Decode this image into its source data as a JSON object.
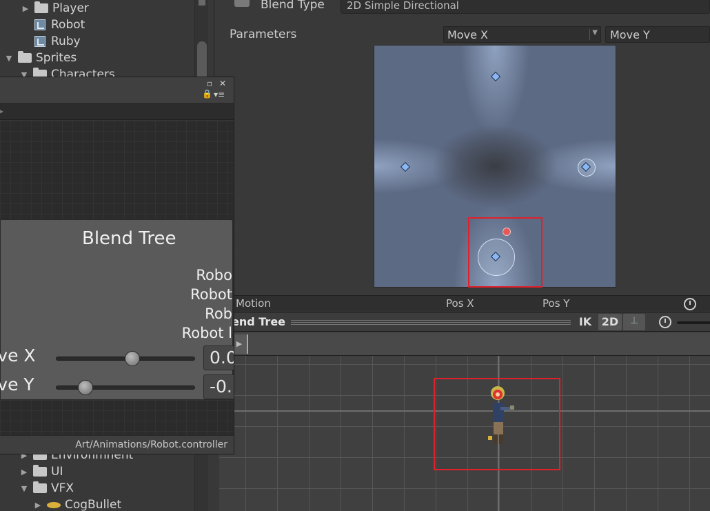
{
  "project_tree": {
    "items": [
      {
        "label": "Player",
        "type": "folder",
        "expander": "▶"
      },
      {
        "label": "Robot",
        "type": "asset",
        "expander": ""
      },
      {
        "label": "Ruby",
        "type": "asset",
        "expander": ""
      },
      {
        "label": "Sprites",
        "type": "folder",
        "expander": "▼"
      },
      {
        "label": "Characters",
        "type": "folder",
        "expander": "▼"
      },
      {
        "label": "Environmnent",
        "type": "folder",
        "expander": "▶"
      },
      {
        "label": "UI",
        "type": "folder",
        "expander": "▶"
      },
      {
        "label": "VFX",
        "type": "folder",
        "expander": "▼"
      },
      {
        "label": "CogBullet",
        "type": "cog",
        "expander": "▶"
      }
    ]
  },
  "inspector": {
    "blend_type_label": "Blend Type",
    "blend_type_value": "2D Simple Directional",
    "parameters_label": "Parameters",
    "param_x": "Move X",
    "param_y": "Move Y",
    "param_x_chevron": "▼"
  },
  "motion_table": {
    "headers": {
      "motion": "Motion",
      "pos_x": "Pos X",
      "pos_y": "Pos Y"
    },
    "clock_icon": "clock-icon"
  },
  "preview": {
    "title": "end Tree",
    "ik_label": "IK",
    "mode_2d_label": "2D",
    "pivot_icon": "⊥",
    "play_icon": "▶"
  },
  "animator": {
    "window_controls": {
      "maximize": "▫",
      "close": "✕",
      "lock": "🔒",
      "menu": "▾≡"
    },
    "crumb_arrow": "▶",
    "node_title": "Blend Tree",
    "node_outputs": [
      "Robo",
      "Robot",
      "Rob",
      "Robot l"
    ],
    "params": [
      {
        "label": "ove X",
        "value": "0.0",
        "level": 0.55
      },
      {
        "label": "ove Y",
        "value": "-0.",
        "level": 0.17
      }
    ],
    "footer_path": "Art/Animations/Robot.controller"
  },
  "colors": {
    "accent_red": "#e0202a",
    "diamond_blue": "#8ab6f2"
  }
}
